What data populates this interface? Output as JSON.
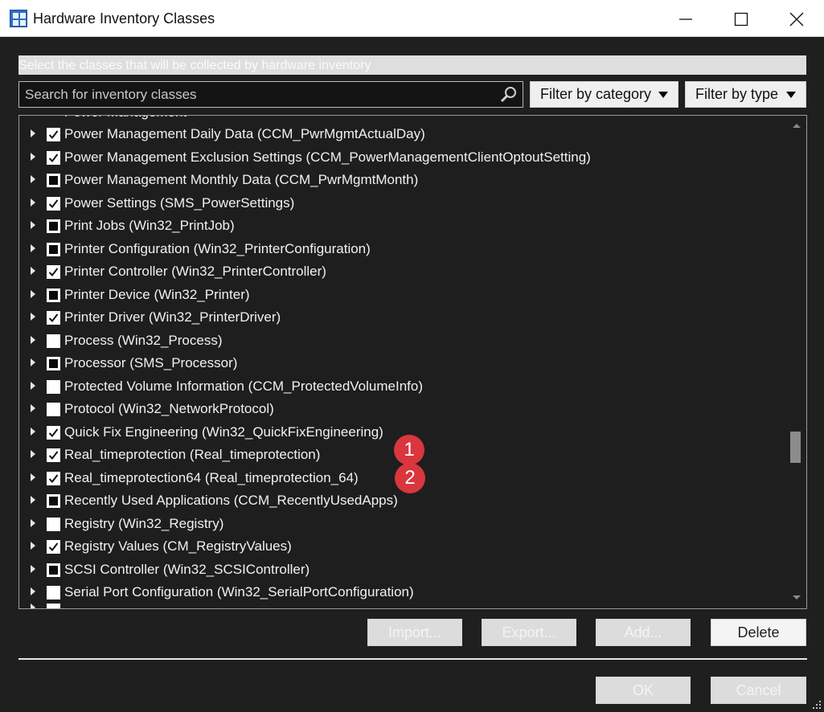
{
  "window": {
    "title": "Hardware Inventory Classes",
    "minimize_icon": "minimize-icon",
    "maximize_icon": "maximize-icon",
    "close_icon": "close-icon"
  },
  "instruction": "Select the classes that will be collected by hardware inventory",
  "search": {
    "placeholder": "Search for inventory classes",
    "icon": "search-icon"
  },
  "filters": {
    "category_label": "Filter by category",
    "type_label": "Filter by type"
  },
  "list": {
    "rows": [
      {
        "label": "Power Management Daily Data (CCM_PwrMgmtActualDay)",
        "state": "checked"
      },
      {
        "label": "Power Management Exclusion Settings (CCM_PowerManagementClientOptoutSetting)",
        "state": "checked"
      },
      {
        "label": "Power Management Monthly Data (CCM_PwrMgmtMonth)",
        "state": "partial"
      },
      {
        "label": "Power Settings (SMS_PowerSettings)",
        "state": "checked"
      },
      {
        "label": "Print Jobs (Win32_PrintJob)",
        "state": "partial"
      },
      {
        "label": "Printer Configuration (Win32_PrinterConfiguration)",
        "state": "partial"
      },
      {
        "label": "Printer Controller (Win32_PrinterController)",
        "state": "checked"
      },
      {
        "label": "Printer Device (Win32_Printer)",
        "state": "partial"
      },
      {
        "label": "Printer Driver (Win32_PrinterDriver)",
        "state": "checked"
      },
      {
        "label": "Process (Win32_Process)",
        "state": "unchecked"
      },
      {
        "label": "Processor (SMS_Processor)",
        "state": "partial"
      },
      {
        "label": "Protected Volume Information (CCM_ProtectedVolumeInfo)",
        "state": "unchecked"
      },
      {
        "label": "Protocol (Win32_NetworkProtocol)",
        "state": "unchecked"
      },
      {
        "label": "Quick Fix Engineering (Win32_QuickFixEngineering)",
        "state": "checked"
      },
      {
        "label": "Real_timeprotection (Real_timeprotection)",
        "state": "checked"
      },
      {
        "label": "Real_timeprotection64 (Real_timeprotection_64)",
        "state": "checked"
      },
      {
        "label": "Recently Used Applications (CCM_RecentlyUsedApps)",
        "state": "partial"
      },
      {
        "label": "Registry (Win32_Registry)",
        "state": "unchecked"
      },
      {
        "label": "Registry Values (CM_RegistryValues)",
        "state": "checked"
      },
      {
        "label": "SCSI Controller (Win32_SCSIController)",
        "state": "partial"
      },
      {
        "label": "Serial Port Configuration (Win32_SerialPortConfiguration)",
        "state": "unchecked"
      }
    ]
  },
  "callouts": [
    "1",
    "2"
  ],
  "buttons": {
    "import": "Import...",
    "export": "Export...",
    "add": "Add...",
    "delete": "Delete",
    "ok": "OK",
    "cancel": "Cancel"
  },
  "colors": {
    "callout": "#d9363e",
    "background": "#1f1f1f",
    "titlebar": "#ffffff"
  }
}
